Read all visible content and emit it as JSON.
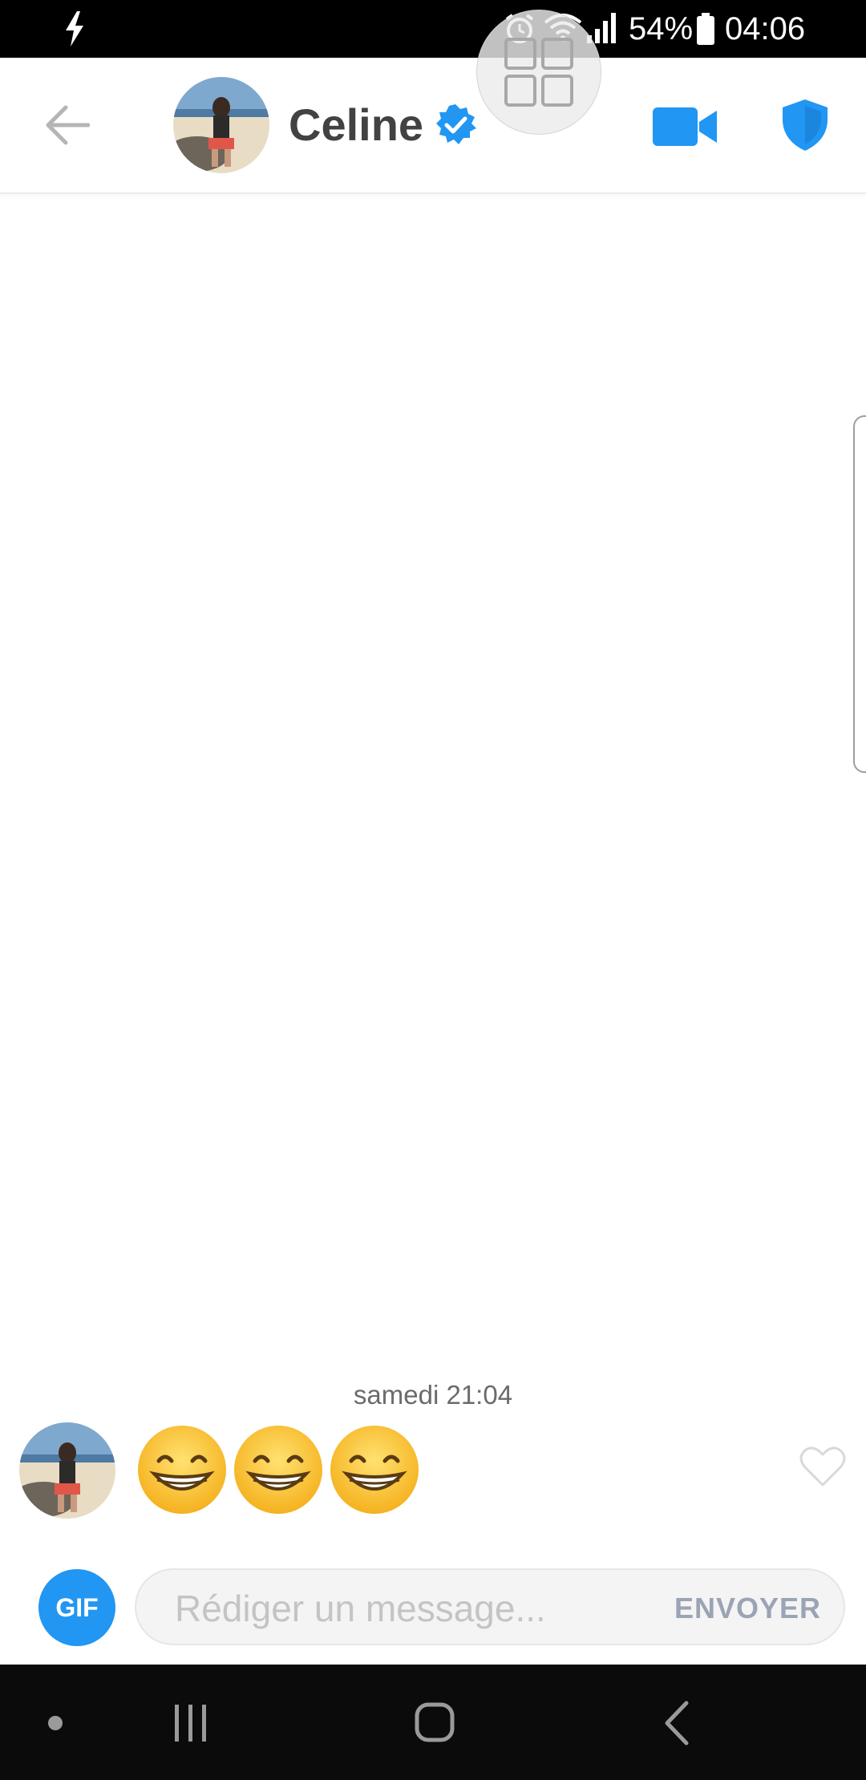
{
  "status_bar": {
    "battery_percent": "54%",
    "time": "04:06",
    "icons": [
      "charging-bolt-icon",
      "alarm-icon",
      "wifi-icon",
      "signal-icon",
      "battery-icon"
    ]
  },
  "header": {
    "contact_name": "Celine",
    "verified": true,
    "icons": [
      "back-arrow-icon",
      "verified-badge-icon",
      "video-camera-icon",
      "shield-icon"
    ]
  },
  "conversation": {
    "timestamp": "samedi 21:04",
    "messages": [
      {
        "from": "Celine",
        "content": "😁😁😁",
        "emoji_count": 3,
        "liked": false
      }
    ]
  },
  "composer": {
    "gif_label": "GIF",
    "placeholder": "Rédiger un message...",
    "send_label": "ENVOYER"
  },
  "nav_bar": {
    "icons": [
      "dot-icon",
      "recents-icon",
      "home-icon",
      "nav-back-icon"
    ]
  },
  "colors": {
    "accent": "#2196F3",
    "header_text": "#424242",
    "send_disabled": "#9aa4b4",
    "emoji_face": "#FDCB3A"
  }
}
